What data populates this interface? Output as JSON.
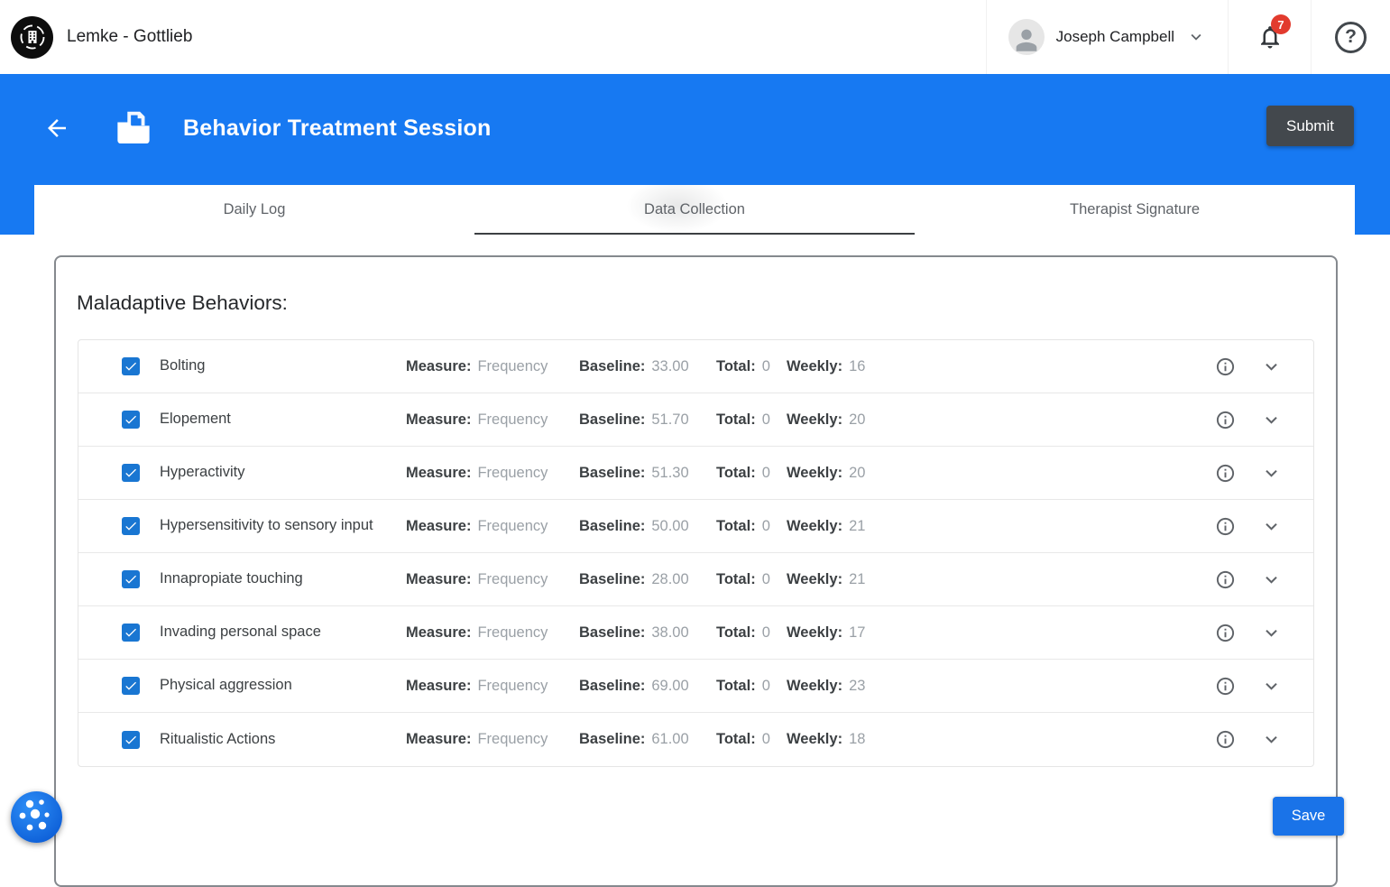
{
  "topbar": {
    "clinic_name": "Lemke - Gottlieb",
    "user_name": "Joseph Campbell",
    "notification_count": "7",
    "help_glyph": "?"
  },
  "header": {
    "title": "Behavior Treatment Session",
    "submit_label": "Submit"
  },
  "tabs": [
    {
      "label": "Daily Log",
      "active": false
    },
    {
      "label": "Data Collection",
      "active": true
    },
    {
      "label": "Therapist Signature",
      "active": false
    }
  ],
  "section": {
    "title": "Maladaptive Behaviors:",
    "labels": {
      "measure": "Measure:",
      "baseline": "Baseline:",
      "total": "Total:",
      "weekly": "Weekly:"
    },
    "rows": [
      {
        "name": "Bolting",
        "measure": "Frequency",
        "baseline": "33.00",
        "total": "0",
        "weekly": "16",
        "checked": true
      },
      {
        "name": "Elopement",
        "measure": "Frequency",
        "baseline": "51.70",
        "total": "0",
        "weekly": "20",
        "checked": true
      },
      {
        "name": "Hyperactivity",
        "measure": "Frequency",
        "baseline": "51.30",
        "total": "0",
        "weekly": "20",
        "checked": true
      },
      {
        "name": "Hypersensitivity to sensory input",
        "measure": "Frequency",
        "baseline": "50.00",
        "total": "0",
        "weekly": "21",
        "checked": true
      },
      {
        "name": "Innapropiate touching",
        "measure": "Frequency",
        "baseline": "28.00",
        "total": "0",
        "weekly": "21",
        "checked": true
      },
      {
        "name": "Invading personal space",
        "measure": "Frequency",
        "baseline": "38.00",
        "total": "0",
        "weekly": "17",
        "checked": true
      },
      {
        "name": "Physical aggression",
        "measure": "Frequency",
        "baseline": "69.00",
        "total": "0",
        "weekly": "23",
        "checked": true
      },
      {
        "name": "Ritualistic Actions",
        "measure": "Frequency",
        "baseline": "61.00",
        "total": "0",
        "weekly": "18",
        "checked": true
      }
    ]
  },
  "footer": {
    "save_label": "Save"
  },
  "colors": {
    "header_blue": "#1779f2",
    "checkbox_blue": "#1976d2",
    "save_blue": "#1a73e8",
    "badge_red": "#e23b2e",
    "submit_gray": "#43484d"
  }
}
